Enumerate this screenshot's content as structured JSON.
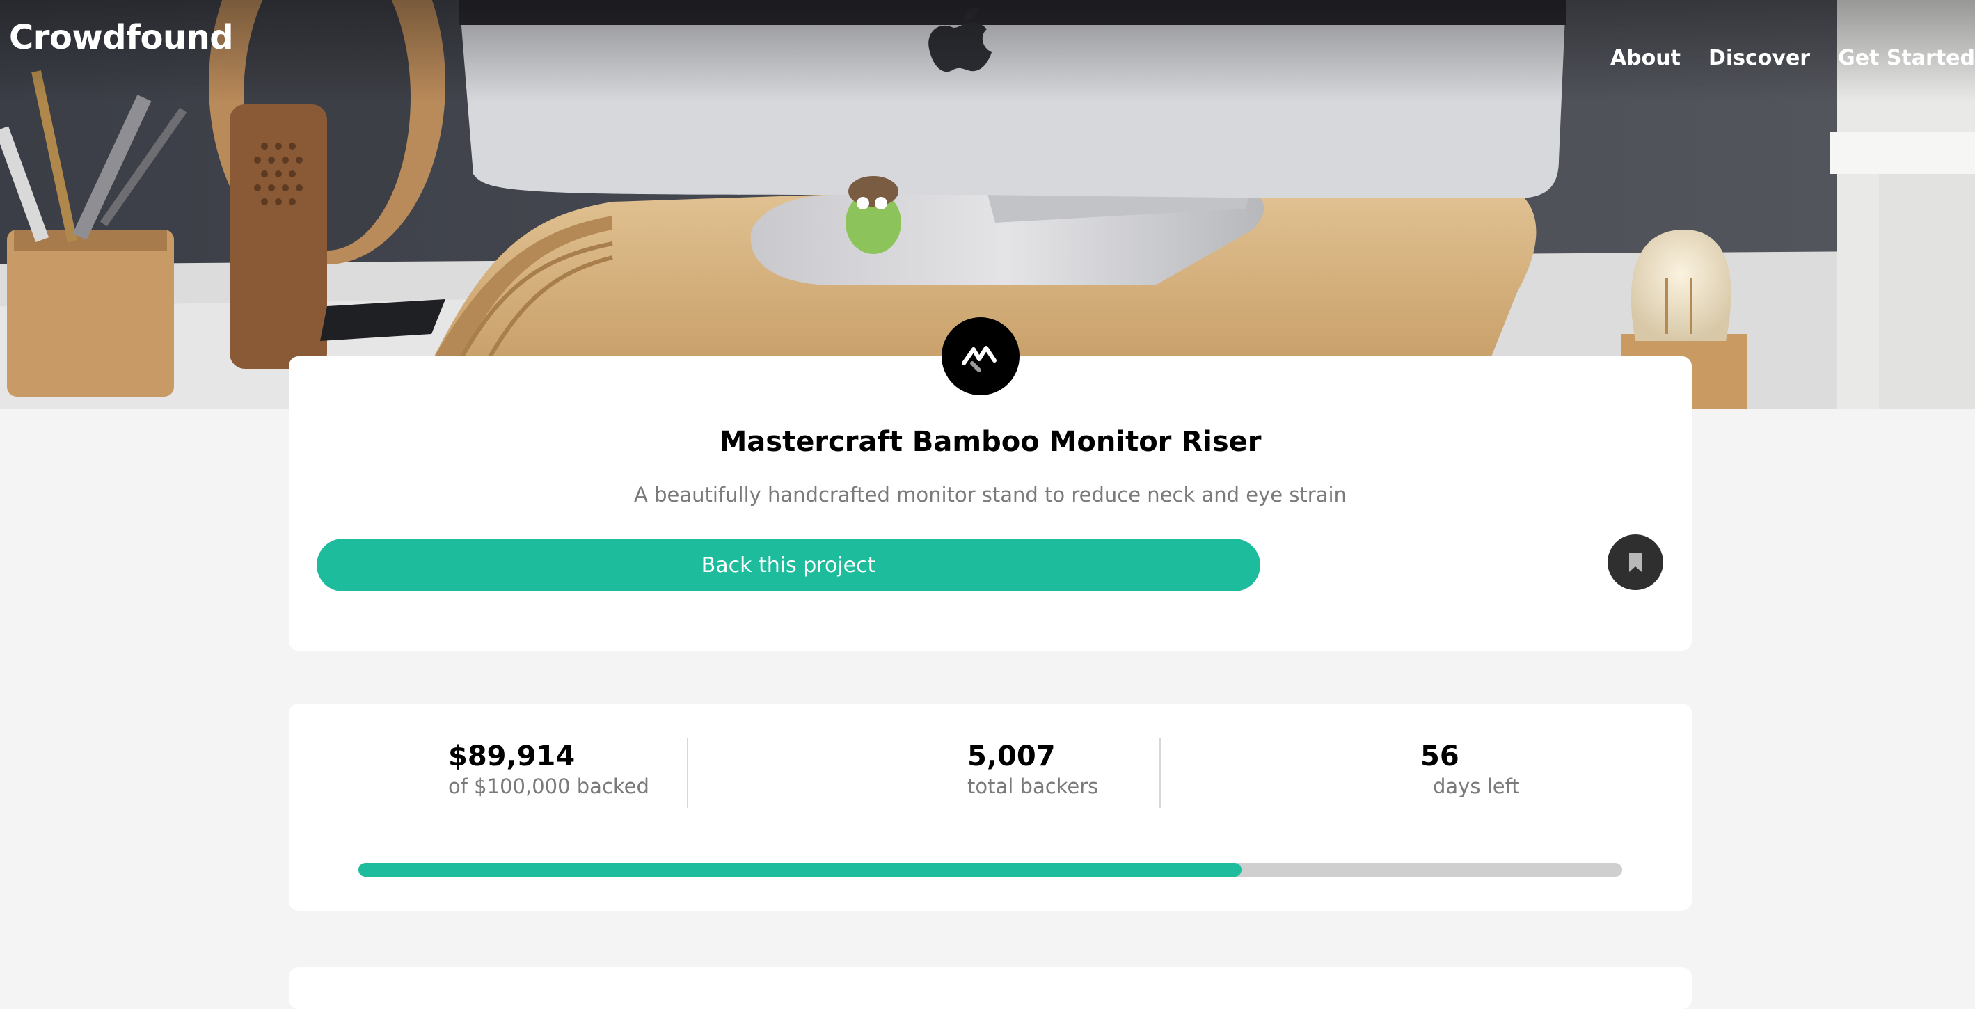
{
  "site": {
    "logo": "Crowdfound",
    "nav": [
      "About",
      "Discover",
      "Get Started"
    ]
  },
  "hero": {
    "image": "desk-with-monitor-on-bamboo-riser"
  },
  "project": {
    "brand_icon": "mastercraft-logo-icon",
    "title": "Mastercraft Bamboo Monitor Riser",
    "subtitle": "A beautifully handcrafted monitor stand to reduce neck and eye strain",
    "back_label": "Back this project",
    "bookmark_icon": "bookmark-icon"
  },
  "stats": {
    "backed": {
      "value": "$89,914",
      "label": "of $100,000 backed"
    },
    "backers": {
      "value": "5,007",
      "label": "total backers"
    },
    "days": {
      "value": "56",
      "label": "days left"
    },
    "progress_fraction": 0.699
  },
  "colors": {
    "accent": "#1cbc9c",
    "background": "#f4f4f4",
    "card": "#ffffff",
    "muted_text": "#7a7a7a",
    "progress_track": "#cfcfcf",
    "bookmark_bg": "#2f2f2f"
  }
}
